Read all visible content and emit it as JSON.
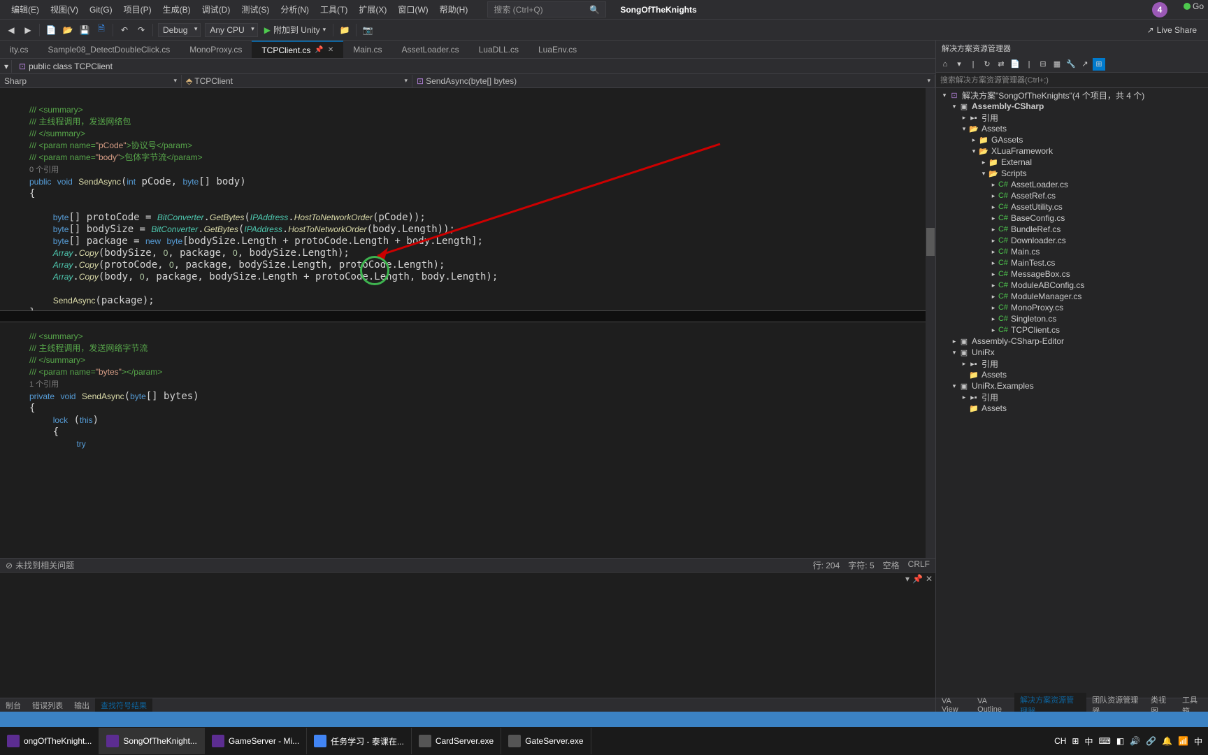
{
  "menu": {
    "items": [
      "编辑(E)",
      "视图(V)",
      "Git(G)",
      "项目(P)",
      "生成(B)",
      "调试(D)",
      "测试(S)",
      "分析(N)",
      "工具(T)",
      "扩展(X)",
      "窗口(W)",
      "帮助(H)"
    ]
  },
  "searchPlaceholder": "搜索 (Ctrl+Q)",
  "appTitle": "SongOfTheKnights",
  "userInitial": "4",
  "toolbar": {
    "config": "Debug",
    "platform": "Any CPU",
    "attachLabel": "附加到 Unity",
    "liveshare": "Live Share"
  },
  "tabs": [
    {
      "label": "ity.cs"
    },
    {
      "label": "Sample08_DetectDoubleClick.cs"
    },
    {
      "label": "MonoProxy.cs"
    },
    {
      "label": "TCPClient.cs",
      "active": true,
      "pinned": true
    },
    {
      "label": "Main.cs"
    },
    {
      "label": "AssetLoader.cs"
    },
    {
      "label": "LuaDLL.cs"
    },
    {
      "label": "LuaEnv.cs"
    }
  ],
  "nav": {
    "scope": "public class TCPClient",
    "goLabel": "Go"
  },
  "scope": {
    "left": "Sharp",
    "mid": "TCPClient",
    "right": "SendAsync(byte[] bytes)"
  },
  "status": {
    "left": "未找到相关问题",
    "line": "行: 204",
    "col": "字符: 5",
    "mode": "空格",
    "crlf": "CRLF"
  },
  "bottomTabs": [
    "制台",
    "错误列表",
    "输出",
    "查找符号结果"
  ],
  "sidebar": {
    "title": "解决方案资源管理器",
    "searchPlaceholder": "搜索解决方案资源管理器(Ctrl+;)",
    "solution": "解决方案\"SongOfTheKnights\"(4 个项目，共 4 个)",
    "bottomTabs": [
      "VA View",
      "VA Outline",
      "解决方案资源管理器",
      "团队资源管理器",
      "类视图",
      "工具箱"
    ]
  },
  "tree": [
    {
      "d": 0,
      "exp": "▾",
      "ico": "sln",
      "bind": "sidebar.solution"
    },
    {
      "d": 1,
      "exp": "▾",
      "ico": "proj",
      "t": "Assembly-CSharp",
      "bold": true
    },
    {
      "d": 2,
      "exp": "▸",
      "ico": "ref",
      "t": "引用"
    },
    {
      "d": 2,
      "exp": "▾",
      "ico": "folder-open",
      "t": "Assets"
    },
    {
      "d": 3,
      "exp": "▸",
      "ico": "folder",
      "t": "GAssets"
    },
    {
      "d": 3,
      "exp": "▾",
      "ico": "folder-open",
      "t": "XLuaFramework"
    },
    {
      "d": 4,
      "exp": "▸",
      "ico": "folder",
      "t": "External"
    },
    {
      "d": 4,
      "exp": "▾",
      "ico": "folder-open",
      "t": "Scripts"
    },
    {
      "d": 5,
      "exp": "▸",
      "ico": "cs",
      "t": "AssetLoader.cs"
    },
    {
      "d": 5,
      "exp": "▸",
      "ico": "cs",
      "t": "AssetRef.cs"
    },
    {
      "d": 5,
      "exp": "▸",
      "ico": "cs",
      "t": "AssetUtility.cs"
    },
    {
      "d": 5,
      "exp": "▸",
      "ico": "cs",
      "t": "BaseConfig.cs"
    },
    {
      "d": 5,
      "exp": "▸",
      "ico": "cs",
      "t": "BundleRef.cs"
    },
    {
      "d": 5,
      "exp": "▸",
      "ico": "cs",
      "t": "Downloader.cs"
    },
    {
      "d": 5,
      "exp": "▸",
      "ico": "cs",
      "t": "Main.cs"
    },
    {
      "d": 5,
      "exp": "▸",
      "ico": "cs",
      "t": "MainTest.cs"
    },
    {
      "d": 5,
      "exp": "▸",
      "ico": "cs",
      "t": "MessageBox.cs"
    },
    {
      "d": 5,
      "exp": "▸",
      "ico": "cs",
      "t": "ModuleABConfig.cs"
    },
    {
      "d": 5,
      "exp": "▸",
      "ico": "cs",
      "t": "ModuleManager.cs"
    },
    {
      "d": 5,
      "exp": "▸",
      "ico": "cs",
      "t": "MonoProxy.cs"
    },
    {
      "d": 5,
      "exp": "▸",
      "ico": "cs",
      "t": "Singleton.cs"
    },
    {
      "d": 5,
      "exp": "▸",
      "ico": "cs",
      "t": "TCPClient.cs"
    },
    {
      "d": 1,
      "exp": "▸",
      "ico": "proj",
      "t": "Assembly-CSharp-Editor"
    },
    {
      "d": 1,
      "exp": "▾",
      "ico": "proj",
      "t": "UniRx"
    },
    {
      "d": 2,
      "exp": "▸",
      "ico": "ref",
      "t": "引用"
    },
    {
      "d": 2,
      "exp": "",
      "ico": "folder",
      "t": "Assets"
    },
    {
      "d": 1,
      "exp": "▾",
      "ico": "proj",
      "t": "UniRx.Examples"
    },
    {
      "d": 2,
      "exp": "▸",
      "ico": "ref",
      "t": "引用"
    },
    {
      "d": 2,
      "exp": "",
      "ico": "folder",
      "t": "Assets"
    }
  ],
  "taskbar": [
    {
      "label": "ongOfTheKnight...",
      "color": "#5c2d91"
    },
    {
      "label": "SongOfTheKnight...",
      "color": "#5c2d91",
      "active": true
    },
    {
      "label": "GameServer - Mi...",
      "color": "#5c2d91"
    },
    {
      "label": "任务学习 - 泰课在...",
      "color": "#4285f4"
    },
    {
      "label": "CardServer.exe",
      "color": "#555"
    },
    {
      "label": "GateServer.exe",
      "color": "#555"
    }
  ],
  "tray": {
    "items": [
      "CH",
      "⊞",
      "中",
      "⌨",
      "◧",
      "🔊",
      "🔗",
      "🔔",
      "📶",
      "中"
    ]
  }
}
